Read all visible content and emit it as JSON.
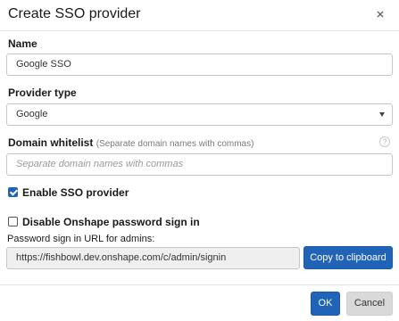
{
  "dialog": {
    "title": "Create SSO provider",
    "close_icon": "close-icon"
  },
  "name_field": {
    "label": "Name",
    "value": "Google SSO"
  },
  "provider_type": {
    "label": "Provider type",
    "selected": "Google"
  },
  "domain_whitelist": {
    "label": "Domain whitelist",
    "hint": "(Separate domain names with commas)",
    "placeholder": "Separate domain names with commas",
    "help_icon": "?"
  },
  "enable_sso": {
    "label": "Enable SSO provider",
    "checked": true
  },
  "disable_password": {
    "label": "Disable Onshape password sign in",
    "checked": false
  },
  "password_url": {
    "label": "Password sign in URL for admins:",
    "value": "https://fishbowl.dev.onshape.com/c/admin/signin",
    "copy_label": "Copy to clipboard"
  },
  "footer": {
    "ok_label": "OK",
    "cancel_label": "Cancel"
  },
  "colors": {
    "accent": "#2164b7",
    "secondary_button": "#d9d9d9",
    "readonly_field": "#efefef"
  }
}
